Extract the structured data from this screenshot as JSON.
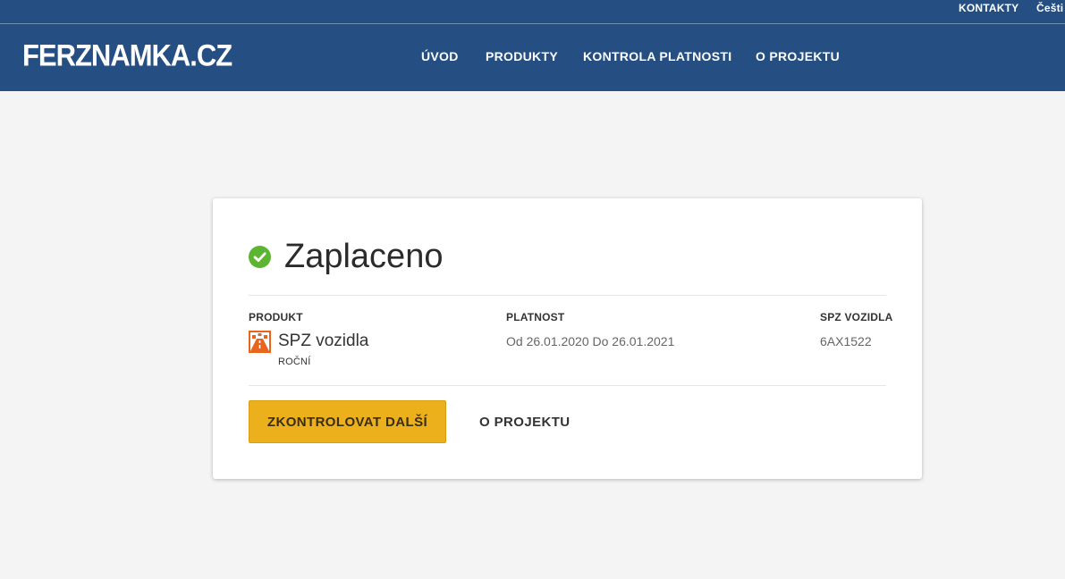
{
  "header": {
    "logo": "FERZNAMKA.CZ",
    "topbar": {
      "contacts": "KONTAKTY",
      "language": "Češti"
    },
    "nav": [
      "ÚVOD",
      "PRODUKTY",
      "KONTROLA PLATNOSTI",
      "O PROJEKTU"
    ]
  },
  "result": {
    "status": "Zaplaceno",
    "status_color": "#5cb531",
    "columns": {
      "product_label": "PRODUKT",
      "validity_label": "PLATNOST",
      "plate_label": "SPZ VOZIDLA"
    },
    "product": {
      "name": "SPZ vozidla",
      "type": "ROČNÍ",
      "icon": "highway-vignette-icon"
    },
    "validity": "Od 26.01.2020 Do 26.01.2021",
    "plate": "6AX1522",
    "actions": {
      "check_another": "ZKONTROLOVAT DALŠÍ",
      "about": "O PROJEKTU"
    }
  },
  "colors": {
    "header_bg": "#254f82",
    "accent": "#ebb01c",
    "page_bg": "#f4f4f4"
  }
}
